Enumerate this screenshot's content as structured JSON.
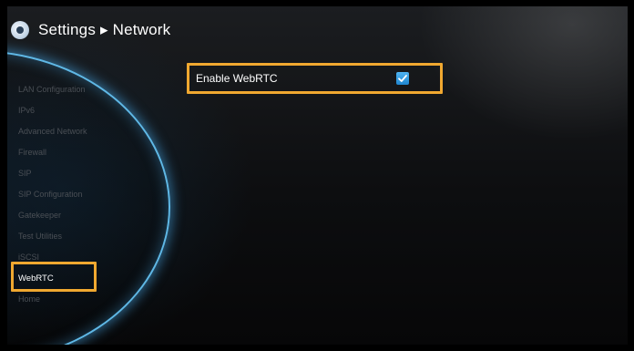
{
  "header": {
    "title": "Settings ▸ Network",
    "icon": "settings-gear-icon"
  },
  "sidebar": {
    "items": [
      {
        "label": "LAN Configuration",
        "active": false
      },
      {
        "label": "IPv6",
        "active": false
      },
      {
        "label": "Advanced Network",
        "active": false
      },
      {
        "label": "Firewall",
        "active": false
      },
      {
        "label": "SIP",
        "active": false
      },
      {
        "label": "SIP Configuration",
        "active": false
      },
      {
        "label": "Gatekeeper",
        "active": false
      },
      {
        "label": "Test Utilities",
        "active": false
      },
      {
        "label": "iSCSI",
        "active": false
      },
      {
        "label": "WebRTC",
        "active": true
      },
      {
        "label": "Home",
        "active": false
      }
    ]
  },
  "main": {
    "setting": {
      "label": "Enable WebRTC",
      "checked": true,
      "icon": "checkmark-icon"
    }
  },
  "colors": {
    "highlight": "#f0a830",
    "accent": "#2a95e0",
    "arc": "#5fb8e6"
  }
}
